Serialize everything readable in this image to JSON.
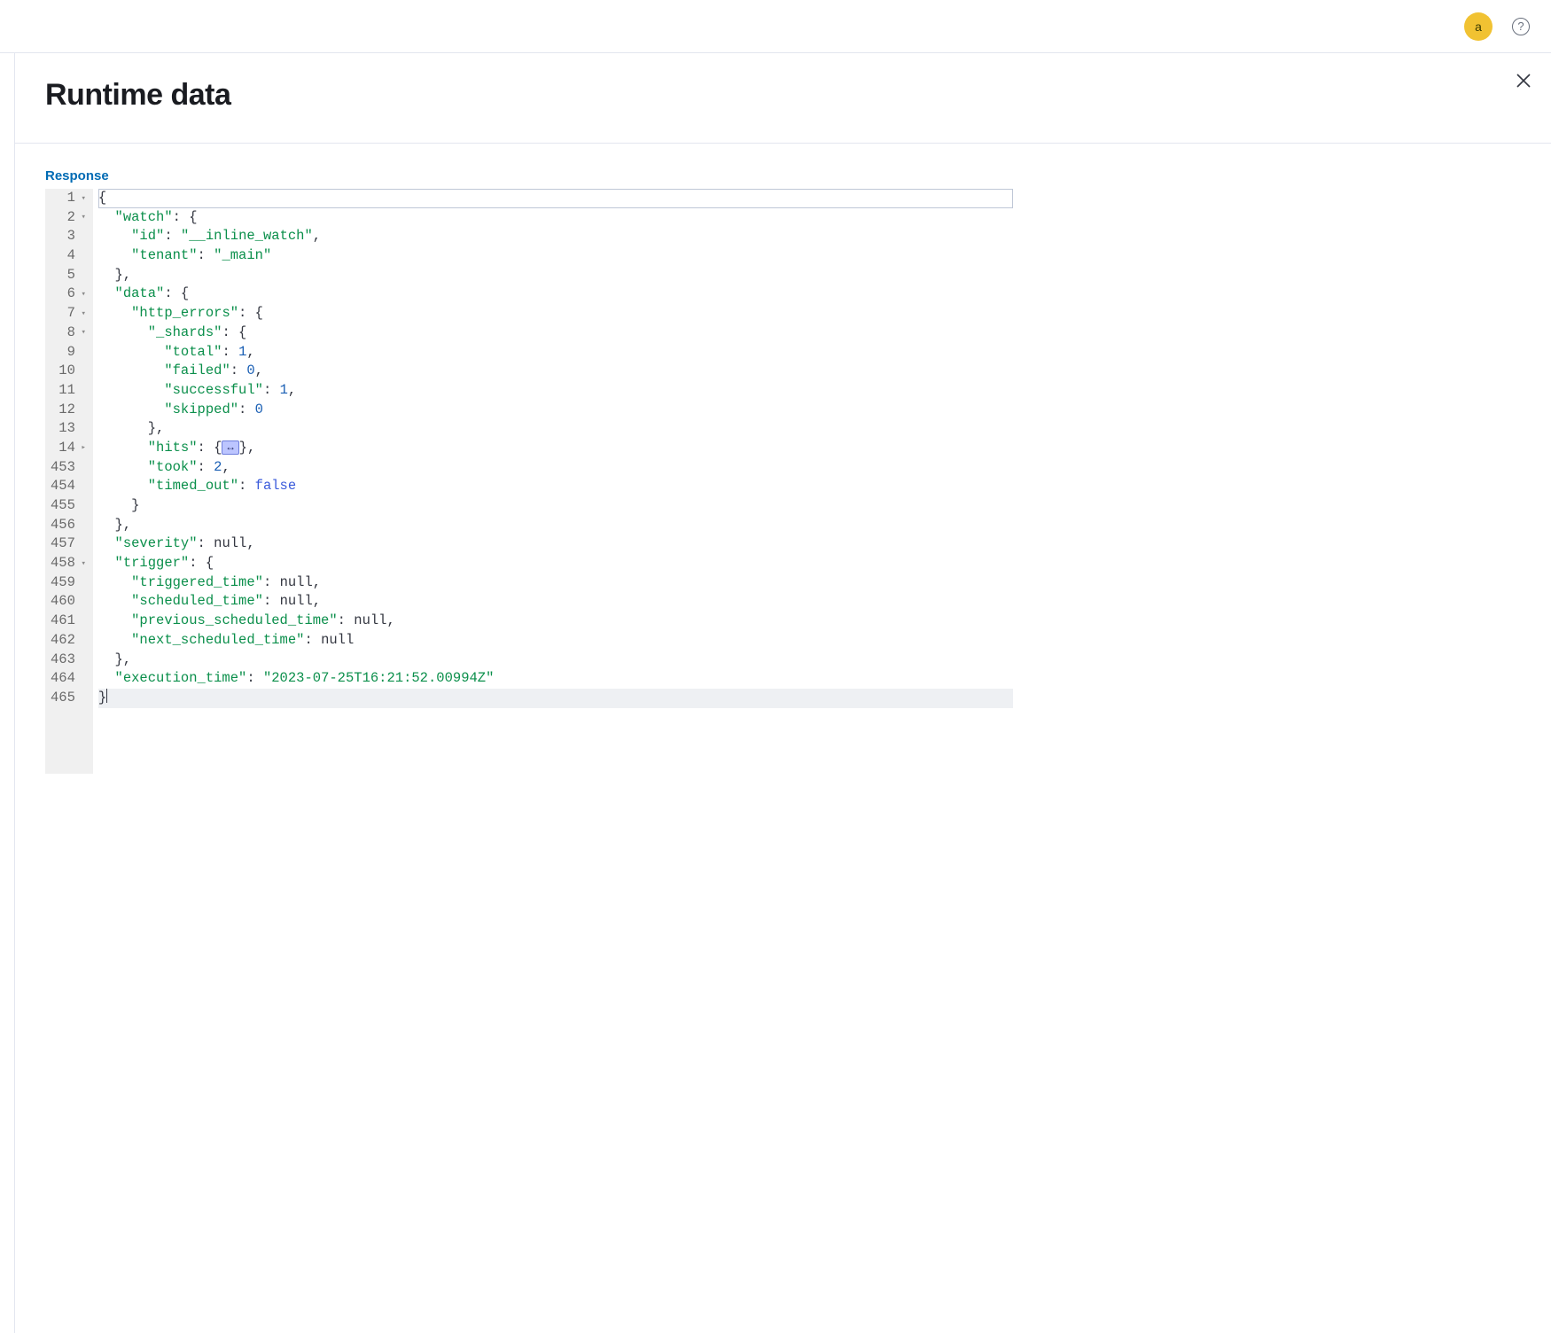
{
  "header": {
    "avatar_letter": "a"
  },
  "panel": {
    "title": "Runtime data",
    "response_label": "Response"
  },
  "code": {
    "collapsed_marker": "↔",
    "cursor_after_line": 25,
    "lines": [
      {
        "n": "1",
        "fold": "▾",
        "tokens": [
          {
            "t": "{",
            "c": "punct"
          }
        ],
        "cursor_box": true
      },
      {
        "n": "2",
        "fold": "▾",
        "tokens": [
          {
            "t": "  ",
            "c": ""
          },
          {
            "t": "\"watch\"",
            "c": "str"
          },
          {
            "t": ": {",
            "c": "punct"
          }
        ]
      },
      {
        "n": "3",
        "fold": "",
        "tokens": [
          {
            "t": "    ",
            "c": ""
          },
          {
            "t": "\"id\"",
            "c": "str"
          },
          {
            "t": ": ",
            "c": "punct"
          },
          {
            "t": "\"__inline_watch\"",
            "c": "str"
          },
          {
            "t": ",",
            "c": "punct"
          }
        ]
      },
      {
        "n": "4",
        "fold": "",
        "tokens": [
          {
            "t": "    ",
            "c": ""
          },
          {
            "t": "\"tenant\"",
            "c": "str"
          },
          {
            "t": ": ",
            "c": "punct"
          },
          {
            "t": "\"_main\"",
            "c": "str"
          }
        ]
      },
      {
        "n": "5",
        "fold": "",
        "tokens": [
          {
            "t": "  },",
            "c": "punct"
          }
        ]
      },
      {
        "n": "6",
        "fold": "▾",
        "tokens": [
          {
            "t": "  ",
            "c": ""
          },
          {
            "t": "\"data\"",
            "c": "str"
          },
          {
            "t": ": {",
            "c": "punct"
          }
        ]
      },
      {
        "n": "7",
        "fold": "▾",
        "tokens": [
          {
            "t": "    ",
            "c": ""
          },
          {
            "t": "\"http_errors\"",
            "c": "str"
          },
          {
            "t": ": {",
            "c": "punct"
          }
        ]
      },
      {
        "n": "8",
        "fold": "▾",
        "tokens": [
          {
            "t": "      ",
            "c": ""
          },
          {
            "t": "\"_shards\"",
            "c": "str"
          },
          {
            "t": ": {",
            "c": "punct"
          }
        ]
      },
      {
        "n": "9",
        "fold": "",
        "tokens": [
          {
            "t": "        ",
            "c": ""
          },
          {
            "t": "\"total\"",
            "c": "str"
          },
          {
            "t": ": ",
            "c": "punct"
          },
          {
            "t": "1",
            "c": "num"
          },
          {
            "t": ",",
            "c": "punct"
          }
        ]
      },
      {
        "n": "10",
        "fold": "",
        "tokens": [
          {
            "t": "        ",
            "c": ""
          },
          {
            "t": "\"failed\"",
            "c": "str"
          },
          {
            "t": ": ",
            "c": "punct"
          },
          {
            "t": "0",
            "c": "num"
          },
          {
            "t": ",",
            "c": "punct"
          }
        ]
      },
      {
        "n": "11",
        "fold": "",
        "tokens": [
          {
            "t": "        ",
            "c": ""
          },
          {
            "t": "\"successful\"",
            "c": "str"
          },
          {
            "t": ": ",
            "c": "punct"
          },
          {
            "t": "1",
            "c": "num"
          },
          {
            "t": ",",
            "c": "punct"
          }
        ]
      },
      {
        "n": "12",
        "fold": "",
        "tokens": [
          {
            "t": "        ",
            "c": ""
          },
          {
            "t": "\"skipped\"",
            "c": "str"
          },
          {
            "t": ": ",
            "c": "punct"
          },
          {
            "t": "0",
            "c": "num"
          }
        ]
      },
      {
        "n": "13",
        "fold": "",
        "tokens": [
          {
            "t": "      },",
            "c": "punct"
          }
        ]
      },
      {
        "n": "14",
        "fold": "▸",
        "tokens": [
          {
            "t": "      ",
            "c": ""
          },
          {
            "t": "\"hits\"",
            "c": "str"
          },
          {
            "t": ": {",
            "c": "punct"
          },
          {
            "t": "",
            "c": "collapsed"
          },
          {
            "t": "},",
            "c": "punct"
          }
        ]
      },
      {
        "n": "453",
        "fold": "",
        "tokens": [
          {
            "t": "      ",
            "c": ""
          },
          {
            "t": "\"took\"",
            "c": "str"
          },
          {
            "t": ": ",
            "c": "punct"
          },
          {
            "t": "2",
            "c": "num"
          },
          {
            "t": ",",
            "c": "punct"
          }
        ]
      },
      {
        "n": "454",
        "fold": "",
        "tokens": [
          {
            "t": "      ",
            "c": ""
          },
          {
            "t": "\"timed_out\"",
            "c": "str"
          },
          {
            "t": ": ",
            "c": "punct"
          },
          {
            "t": "false",
            "c": "kw"
          }
        ]
      },
      {
        "n": "455",
        "fold": "",
        "tokens": [
          {
            "t": "    }",
            "c": "punct"
          }
        ]
      },
      {
        "n": "456",
        "fold": "",
        "tokens": [
          {
            "t": "  },",
            "c": "punct"
          }
        ]
      },
      {
        "n": "457",
        "fold": "",
        "tokens": [
          {
            "t": "  ",
            "c": ""
          },
          {
            "t": "\"severity\"",
            "c": "str"
          },
          {
            "t": ": ",
            "c": "punct"
          },
          {
            "t": "null",
            "c": "punct"
          },
          {
            "t": ",",
            "c": "punct"
          }
        ]
      },
      {
        "n": "458",
        "fold": "▾",
        "tokens": [
          {
            "t": "  ",
            "c": ""
          },
          {
            "t": "\"trigger\"",
            "c": "str"
          },
          {
            "t": ": {",
            "c": "punct"
          }
        ]
      },
      {
        "n": "459",
        "fold": "",
        "tokens": [
          {
            "t": "    ",
            "c": ""
          },
          {
            "t": "\"triggered_time\"",
            "c": "str"
          },
          {
            "t": ": ",
            "c": "punct"
          },
          {
            "t": "null",
            "c": "punct"
          },
          {
            "t": ",",
            "c": "punct"
          }
        ]
      },
      {
        "n": "460",
        "fold": "",
        "tokens": [
          {
            "t": "    ",
            "c": ""
          },
          {
            "t": "\"scheduled_time\"",
            "c": "str"
          },
          {
            "t": ": ",
            "c": "punct"
          },
          {
            "t": "null",
            "c": "punct"
          },
          {
            "t": ",",
            "c": "punct"
          }
        ]
      },
      {
        "n": "461",
        "fold": "",
        "tokens": [
          {
            "t": "    ",
            "c": ""
          },
          {
            "t": "\"previous_scheduled_time\"",
            "c": "str"
          },
          {
            "t": ": ",
            "c": "punct"
          },
          {
            "t": "null",
            "c": "punct"
          },
          {
            "t": ",",
            "c": "punct"
          }
        ]
      },
      {
        "n": "462",
        "fold": "",
        "tokens": [
          {
            "t": "    ",
            "c": ""
          },
          {
            "t": "\"next_scheduled_time\"",
            "c": "str"
          },
          {
            "t": ": ",
            "c": "punct"
          },
          {
            "t": "null",
            "c": "punct"
          }
        ]
      },
      {
        "n": "463",
        "fold": "",
        "tokens": [
          {
            "t": "  },",
            "c": "punct"
          }
        ]
      },
      {
        "n": "464",
        "fold": "",
        "tokens": [
          {
            "t": "  ",
            "c": ""
          },
          {
            "t": "\"execution_time\"",
            "c": "str"
          },
          {
            "t": ": ",
            "c": "punct"
          },
          {
            "t": "\"2023-07-25T16:21:52.00994Z\"",
            "c": "str"
          }
        ]
      },
      {
        "n": "465",
        "fold": "",
        "tokens": [
          {
            "t": "}",
            "c": "punct"
          }
        ],
        "hl": true,
        "cursor_after": true
      }
    ]
  }
}
